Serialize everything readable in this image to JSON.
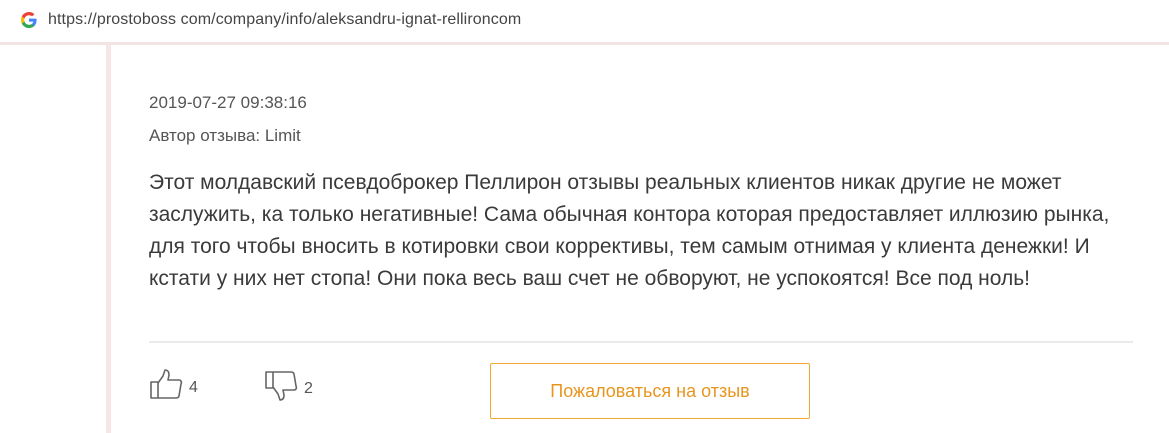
{
  "browser": {
    "url": "https://prostoboss com/company/info/aleksandru-ignat-rellironcom",
    "icon": "google-g-icon"
  },
  "review": {
    "datetime": "2019-07-27 09:38:16",
    "author_line": "Автор отзыва: Limit",
    "text": "Этот молдавский псевдоброкер Пеллирон отзывы реальных клиентов никак другие не может заслужить, ка только негативные! Сама обычная контора которая предоставляет иллюзию рынка, для того чтобы вносить в котировки свои коррективы, тем самым отнимая у клиента денежки! И кстати у них нет стопа! Они пока весь ваш счет не обворуют, не успокоятся! Все под ноль!",
    "likes": "4",
    "dislikes": "2",
    "report_label": "Пожаловаться на отзыв"
  },
  "colors": {
    "accent_orange": "#f0a830",
    "text": "#3a3a3a",
    "muted": "#555555"
  }
}
